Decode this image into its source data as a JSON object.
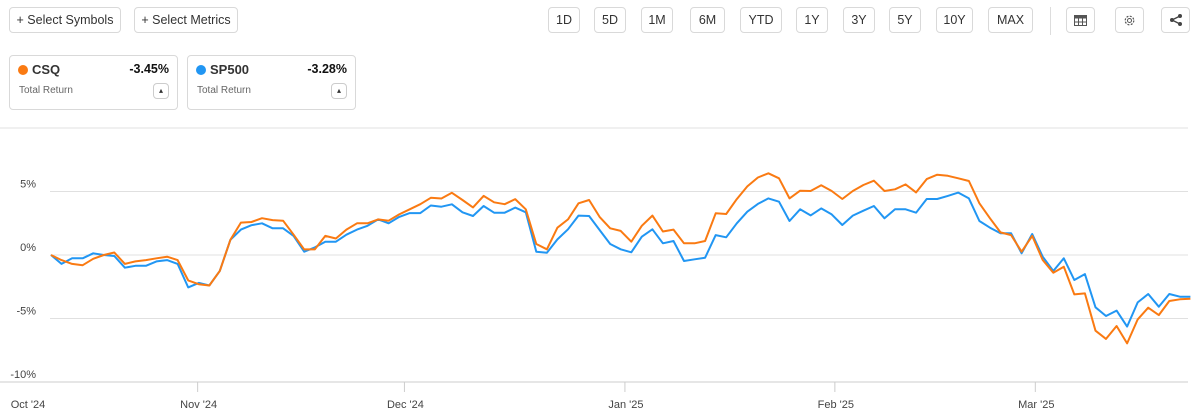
{
  "toolbar": {
    "select_symbols": "+ Select Symbols",
    "select_metrics": "+ Select Metrics",
    "periods": [
      "1D",
      "5D",
      "1M",
      "6M",
      "YTD",
      "1Y",
      "3Y",
      "5Y",
      "10Y",
      "MAX"
    ],
    "icons": [
      "table-icon",
      "settings-gear-icon",
      "share-icon"
    ]
  },
  "cards": [
    {
      "symbol": "CSQ",
      "value": "-3.45%",
      "metric": "Total Return",
      "color": "#fa7a12"
    },
    {
      "symbol": "SP500",
      "value": "-3.28%",
      "metric": "Total Return",
      "color": "#2196f3"
    }
  ],
  "chart_data": {
    "type": "line",
    "ylim": [
      -10,
      10
    ],
    "yticks": [
      {
        "v": 5,
        "label": "5%"
      },
      {
        "v": 0,
        "label": "0%"
      },
      {
        "v": -5,
        "label": "-5%"
      },
      {
        "v": -10,
        "label": "-10%"
      }
    ],
    "grid": true,
    "x_ticks": [
      {
        "i": 0,
        "label": "Oct '24"
      },
      {
        "i": 13.9,
        "label": "Nov '24"
      },
      {
        "i": 33.5,
        "label": "Dec '24"
      },
      {
        "i": 54.4,
        "label": "Jan '25"
      },
      {
        "i": 74.3,
        "label": "Feb '25"
      },
      {
        "i": 93.3,
        "label": "Mar '25"
      }
    ],
    "series": [
      {
        "name": "CSQ",
        "color": "#fa7a12",
        "values": [
          0,
          -0.4,
          -0.7,
          -0.8,
          -0.3,
          0,
          0.2,
          -0.7,
          -0.5,
          -0.4,
          -0.26,
          -0.13,
          -0.4,
          -2.0,
          -2.3,
          -2.4,
          -1.25,
          1.2,
          2.55,
          2.6,
          2.9,
          2.75,
          2.7,
          1.6,
          0.44,
          0.44,
          1.5,
          1.3,
          2.0,
          2.5,
          2.5,
          2.8,
          2.7,
          3.2,
          3.6,
          4.0,
          4.5,
          4.45,
          4.9,
          4.33,
          3.75,
          4.65,
          4.15,
          4.0,
          4.4,
          3.6,
          0.87,
          0.45,
          2.15,
          2.8,
          4.07,
          4.33,
          3.0,
          2.1,
          1.9,
          1.05,
          2.3,
          3.1,
          1.85,
          2.0,
          0.92,
          0.92,
          1.1,
          3.28,
          3.23,
          4.4,
          5.4,
          6.1,
          6.43,
          6.04,
          4.46,
          5.06,
          5.04,
          5.5,
          5.04,
          4.41,
          5.04,
          5.51,
          5.85,
          5.04,
          5.17,
          5.56,
          4.93,
          5.98,
          6.32,
          6.24,
          6.04,
          5.83,
          4.07,
          2.89,
          1.78,
          1.57,
          0.26,
          1.5,
          -0.39,
          -1.39,
          -0.92,
          -3.1,
          -3.02,
          -5.96,
          -6.61,
          -5.59,
          -6.96,
          -5.07,
          -4.15,
          -4.73,
          -3.62,
          -3.49,
          -3.45
        ]
      },
      {
        "name": "SP500",
        "color": "#2196f3",
        "values": [
          0,
          -0.7,
          -0.26,
          -0.26,
          0.13,
          0,
          -0.08,
          -1.0,
          -0.85,
          -0.85,
          -0.5,
          -0.4,
          -0.7,
          -2.55,
          -2.2,
          -2.4,
          -1.25,
          1.2,
          2.0,
          2.35,
          2.5,
          2.1,
          2.1,
          1.5,
          0.26,
          0.6,
          1.05,
          1.05,
          1.6,
          2.0,
          2.3,
          2.8,
          2.5,
          3.0,
          3.3,
          3.3,
          3.9,
          3.8,
          3.99,
          3.36,
          3.07,
          3.86,
          3.33,
          3.33,
          3.73,
          3.36,
          0.26,
          0.18,
          1.23,
          2.02,
          3.1,
          3.07,
          1.97,
          0.87,
          0.45,
          0.21,
          1.44,
          2.02,
          0.92,
          1.1,
          -0.47,
          -0.34,
          -0.21,
          1.57,
          1.39,
          2.5,
          3.41,
          4.02,
          4.46,
          4.2,
          2.68,
          3.6,
          3.12,
          3.67,
          3.2,
          2.36,
          3.1,
          3.49,
          3.86,
          2.89,
          3.6,
          3.6,
          3.33,
          4.41,
          4.41,
          4.65,
          4.91,
          4.46,
          2.68,
          2.15,
          1.71,
          1.71,
          0.13,
          1.65,
          -0.13,
          -1.26,
          -0.26,
          -1.97,
          -1.5,
          -4.12,
          -4.8,
          -4.38,
          -5.64,
          -3.73,
          -3.07,
          -4.07,
          -3.07,
          -3.28,
          -3.28
        ]
      }
    ]
  }
}
